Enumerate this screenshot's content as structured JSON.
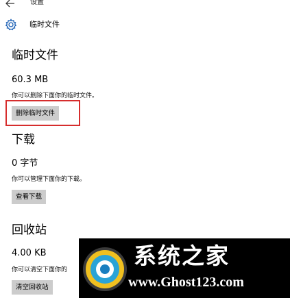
{
  "window": {
    "app_title": "设置",
    "back_icon": "back-arrow-icon"
  },
  "header": {
    "icon": "gear-icon",
    "title": "临时文件"
  },
  "sections": [
    {
      "title": "临时文件",
      "size": "60.3 MB",
      "description": "你可以删除下面你的临时文件。",
      "button_label": "删除临时文件"
    },
    {
      "title": "下载",
      "size": "0 字节",
      "description": "你可以管理下面你的下载。",
      "button_label": "查看下载"
    },
    {
      "title": "回收站",
      "size": "4.00 KB",
      "description": "你可以清空下面你的",
      "button_label": "清空回收站"
    }
  ],
  "watermark": {
    "name": "系统之家",
    "url": "www.Ghost123.com"
  },
  "colors": {
    "accent": "#1a5fb4",
    "highlight": "#d62d2d",
    "button_bg": "#cccccc"
  }
}
